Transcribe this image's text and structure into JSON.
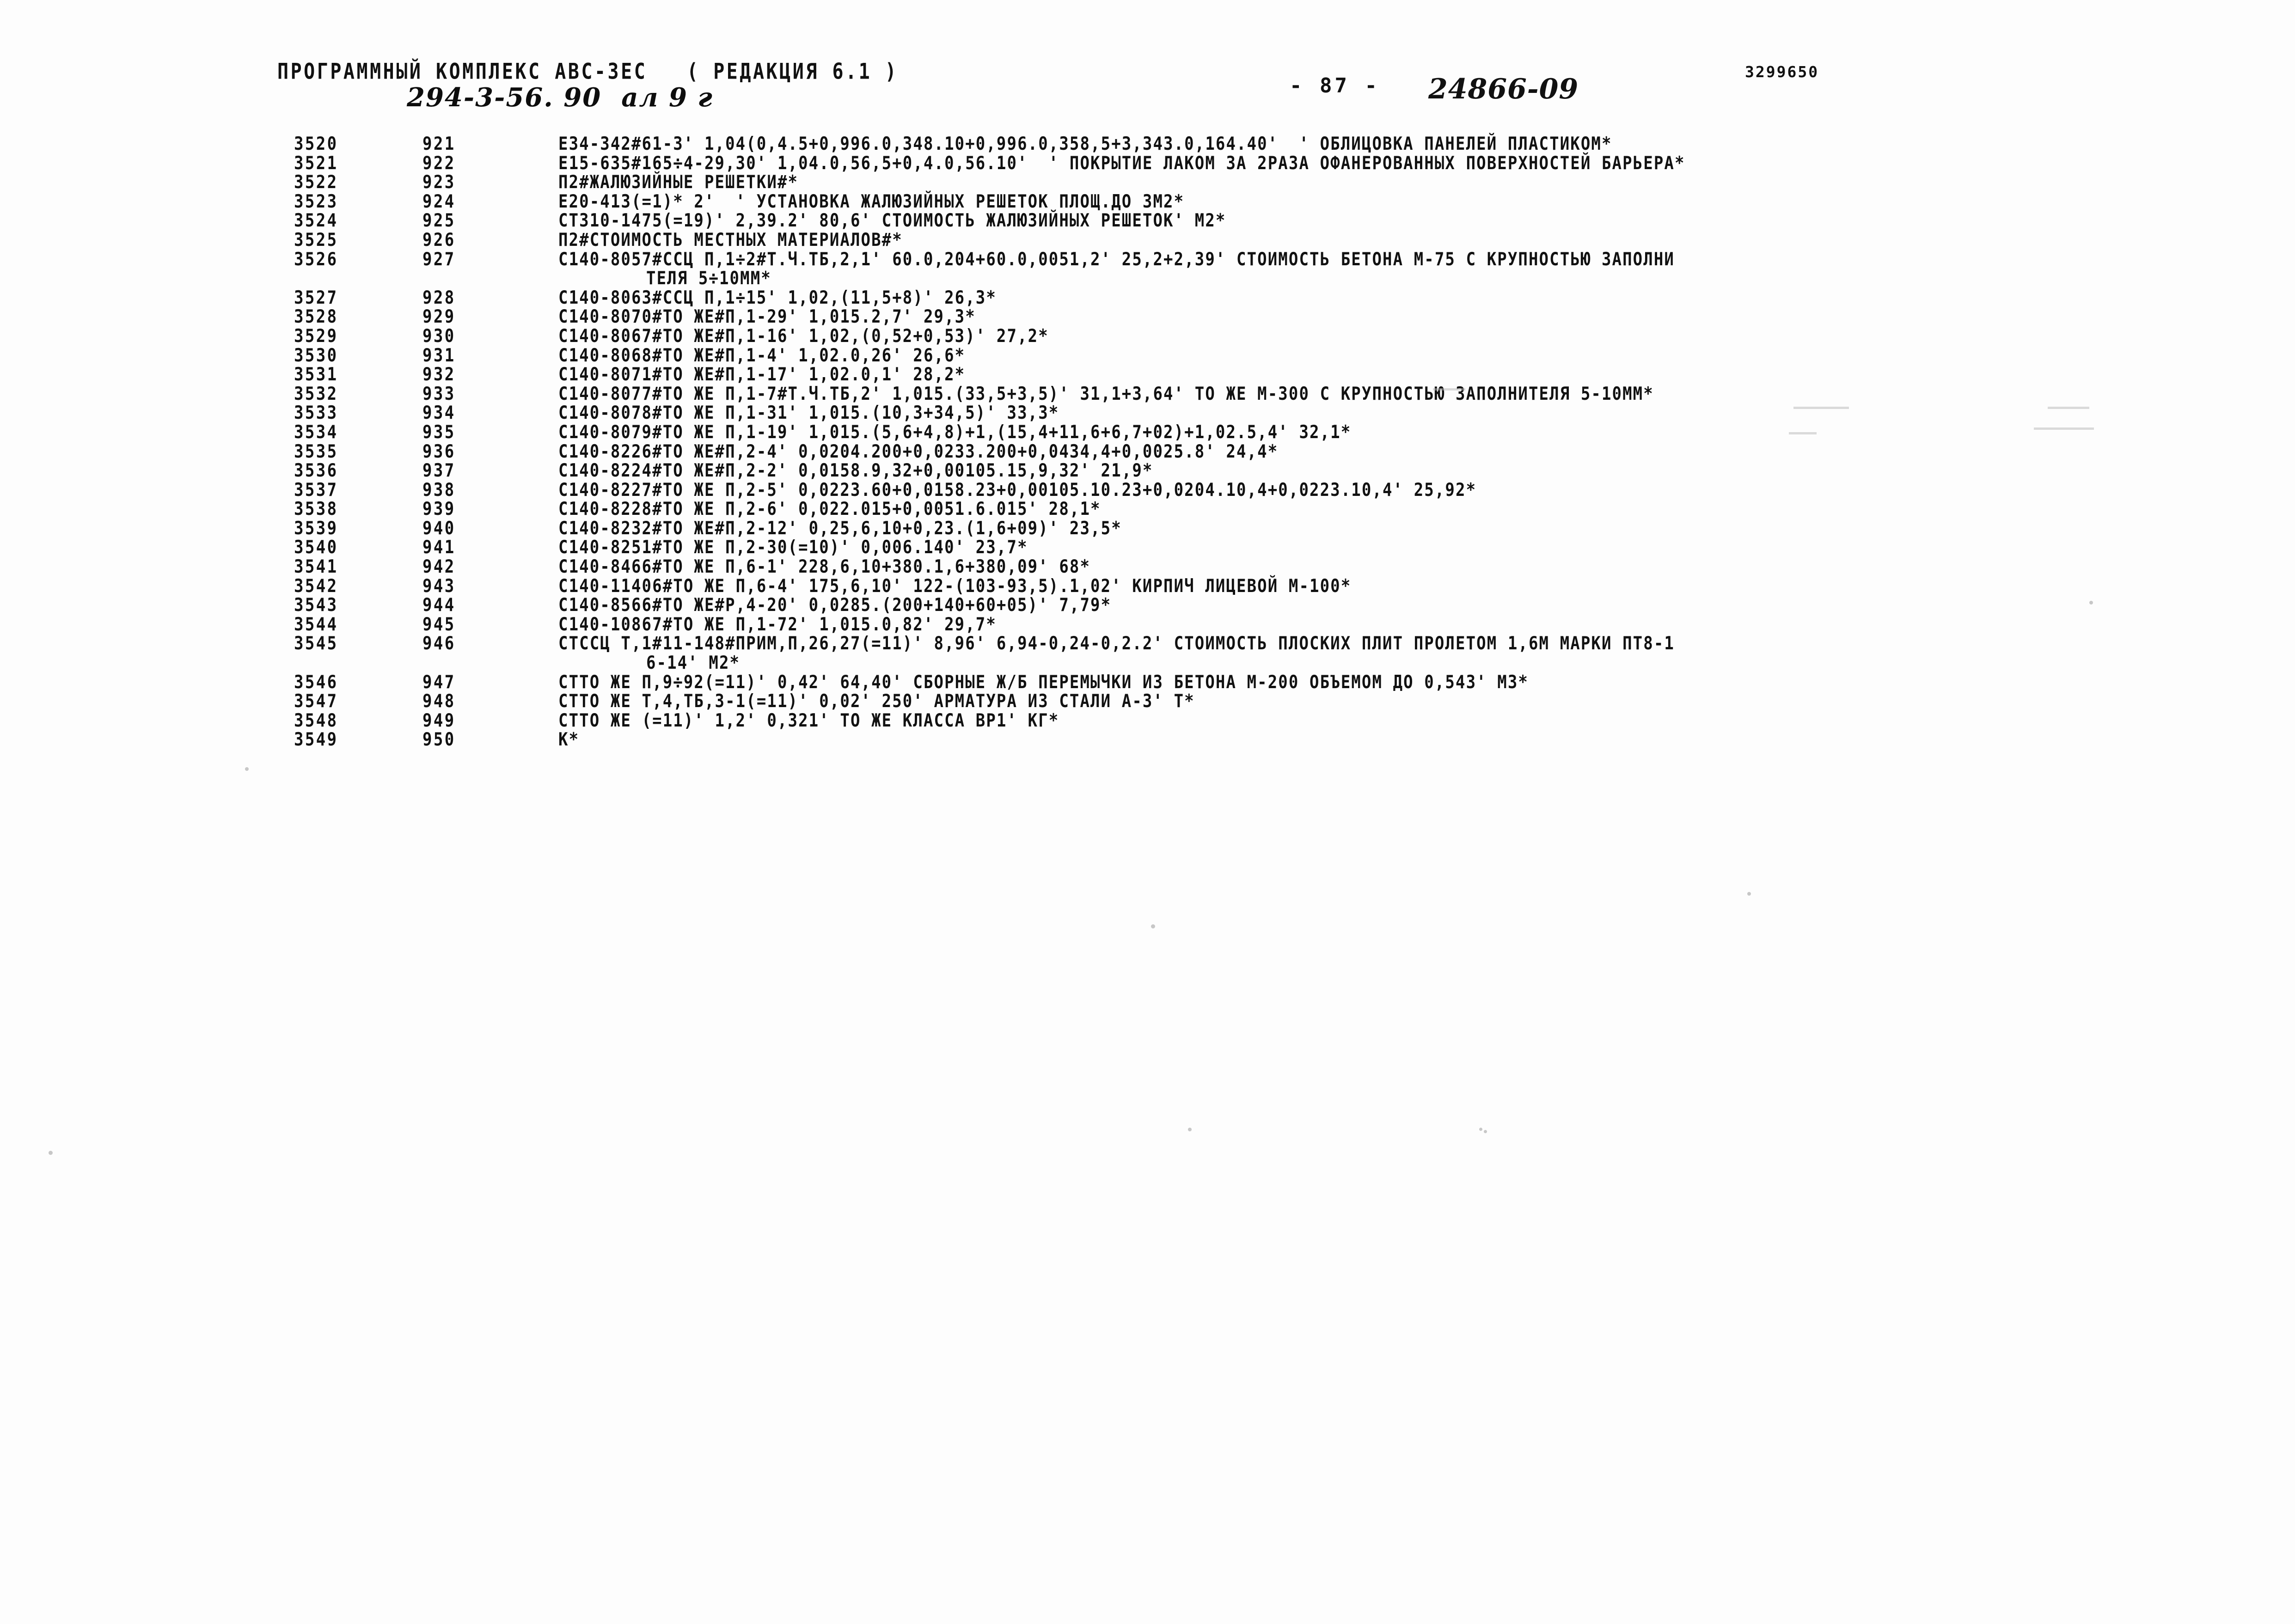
{
  "header": {
    "title": "ПРОГРАММНЫЙ КОМПЛЕКС АВС-3ЕС   ( РЕДАКЦИЯ 6.1 )",
    "handwritten_note": "294-3-56. 90  ал 9 г",
    "page_marker": "- 87 -",
    "handwritten_doc_number": "24866-09",
    "document_code": "3299650"
  },
  "listing": {
    "columns": [
      "seq",
      "num",
      "text"
    ],
    "rows": [
      {
        "seq": "3520",
        "num": "921",
        "text": "E34-342#61-3' 1,04(0,4.5+0,996.0,348.10+0,996.0,358,5+3,343.0,164.40'  ' ОБЛИЦОВКА ПАНЕЛЕЙ ПЛАСТИКОМ*",
        "continuation": false
      },
      {
        "seq": "3521",
        "num": "922",
        "text": "E15-635#165÷4-29,30' 1,04.0,56,5+0,4.0,56.10'  ' ПОКРЫТИЕ ЛАКОМ ЗА 2РАЗА ОФАНЕРОВАННЫХ ПОВЕРХНОСТЕЙ БАРЬЕРА*",
        "continuation": false
      },
      {
        "seq": "3522",
        "num": "923",
        "text": "П2#ЖАЛЮЗИЙНЫЕ РЕШЕТКИ#*",
        "continuation": false
      },
      {
        "seq": "3523",
        "num": "924",
        "text": "E20-413(=1)* 2'  ' УСТАНОВКА ЖАЛЮЗИЙНЫХ РЕШЕТОК ПЛОЩ.ДО 3М2*",
        "continuation": false
      },
      {
        "seq": "3524",
        "num": "925",
        "text": "СТ310-1475(=19)' 2,39.2' 80,6' СТОИМОСТЬ ЖАЛЮЗИЙНЫХ РЕШЕТОК' М2*",
        "continuation": false
      },
      {
        "seq": "3525",
        "num": "926",
        "text": "П2#СТОИМОСТЬ МЕСТНЫХ МАТЕРИАЛОВ#*",
        "continuation": false
      },
      {
        "seq": "3526",
        "num": "927",
        "text": "С140-8057#ССЦ П,1÷2#Т.Ч.ТБ,2,1' 60.0,204+60.0,0051,2' 25,2+2,39' СТОИМОСТЬ БЕТОНА М-75 С КРУПНОСТЬЮ ЗАПОЛНИ",
        "continuation": false
      },
      {
        "seq": "",
        "num": "",
        "text": "ТЕЛЯ 5÷10ММ*",
        "continuation": true
      },
      {
        "seq": "3527",
        "num": "928",
        "text": "С140-8063#ССЦ П,1÷15' 1,02,(11,5+8)' 26,3*",
        "continuation": false
      },
      {
        "seq": "3528",
        "num": "929",
        "text": "С140-8070#ТО ЖЕ#П,1-29' 1,015.2,7' 29,3*",
        "continuation": false
      },
      {
        "seq": "3529",
        "num": "930",
        "text": "С140-8067#ТО ЖЕ#П,1-16' 1,02,(0,52+0,53)' 27,2*",
        "continuation": false
      },
      {
        "seq": "3530",
        "num": "931",
        "text": "С140-8068#ТО ЖЕ#П,1-4' 1,02.0,26' 26,6*",
        "continuation": false
      },
      {
        "seq": "3531",
        "num": "932",
        "text": "С140-8071#ТО ЖЕ#П,1-17' 1,02.0,1' 28,2*",
        "continuation": false
      },
      {
        "seq": "3532",
        "num": "933",
        "text": "С140-8077#ТО ЖЕ П,1-7#Т.Ч.ТБ,2' 1,015.(33,5+3,5)' 31,1+3,64' ТО ЖЕ М-300 С КРУПНОСТЬЮ ЗАПОЛНИТЕЛЯ 5-10ММ*",
        "continuation": false
      },
      {
        "seq": "3533",
        "num": "934",
        "text": "С140-8078#ТО ЖЕ П,1-31' 1,015.(10,3+34,5)' 33,3*",
        "continuation": false
      },
      {
        "seq": "3534",
        "num": "935",
        "text": "С140-8079#ТО ЖЕ П,1-19' 1,015.(5,6+4,8)+1,(15,4+11,6+6,7+02)+1,02.5,4' 32,1*",
        "continuation": false
      },
      {
        "seq": "3535",
        "num": "936",
        "text": "С140-8226#ТО ЖЕ#П,2-4' 0,0204.200+0,0233.200+0,0434,4+0,0025.8' 24,4*",
        "continuation": false
      },
      {
        "seq": "3536",
        "num": "937",
        "text": "С140-8224#ТО ЖЕ#П,2-2' 0,0158.9,32+0,00105.15,9,32' 21,9*",
        "continuation": false
      },
      {
        "seq": "3537",
        "num": "938",
        "text": "С140-8227#ТО ЖЕ П,2-5' 0,0223.60+0,0158.23+0,00105.10.23+0,0204.10,4+0,0223.10,4' 25,92*",
        "continuation": false
      },
      {
        "seq": "3538",
        "num": "939",
        "text": "С140-8228#ТО ЖЕ П,2-6' 0,022.015+0,0051.6.015' 28,1*",
        "continuation": false
      },
      {
        "seq": "3539",
        "num": "940",
        "text": "С140-8232#ТО ЖЕ#П,2-12' 0,25,6,10+0,23.(1,6+09)' 23,5*",
        "continuation": false
      },
      {
        "seq": "3540",
        "num": "941",
        "text": "С140-8251#ТО ЖЕ П,2-30(=10)' 0,006.140' 23,7*",
        "continuation": false
      },
      {
        "seq": "3541",
        "num": "942",
        "text": "С140-8466#ТО ЖЕ П,6-1' 228,6,10+380.1,6+380,09' 68*",
        "continuation": false
      },
      {
        "seq": "3542",
        "num": "943",
        "text": "С140-11406#ТО ЖЕ П,6-4' 175,6,10' 122-(103-93,5).1,02' КИРПИЧ ЛИЦЕВОЙ М-100*",
        "continuation": false
      },
      {
        "seq": "3543",
        "num": "944",
        "text": "С140-8566#ТО ЖЕ#Р,4-20' 0,0285.(200+140+60+05)' 7,79*",
        "continuation": false
      },
      {
        "seq": "3544",
        "num": "945",
        "text": "С140-10867#ТО ЖЕ П,1-72' 1,015.0,82' 29,7*",
        "continuation": false
      },
      {
        "seq": "3545",
        "num": "946",
        "text": "СТССЦ Т,1#11-148#ПРИМ,П,26,27(=11)' 8,96' 6,94-0,24-0,2.2' СТОИМОСТЬ ПЛОСКИХ ПЛИТ ПРОЛЕТОМ 1,6М МАРКИ ПТ8-1",
        "continuation": false
      },
      {
        "seq": "",
        "num": "",
        "text": "6-14' М2*",
        "continuation": true
      },
      {
        "seq": "3546",
        "num": "947",
        "text": "СТТО ЖЕ П,9÷92(=11)' 0,42' 64,40' СБОРНЫЕ Ж/Б ПЕРЕМЫЧКИ ИЗ БЕТОНА М-200 ОБЪЕМОМ ДО 0,543' М3*",
        "continuation": false
      },
      {
        "seq": "3547",
        "num": "948",
        "text": "СТТО ЖЕ Т,4,ТБ,3-1(=11)' 0,02' 250' АРМАТУРА ИЗ СТАЛИ А-3' Т*",
        "continuation": false
      },
      {
        "seq": "3548",
        "num": "949",
        "text": "СТТО ЖЕ (=11)' 1,2' 0,321' ТО ЖЕ КЛАССА ВР1' КГ*",
        "continuation": false
      },
      {
        "seq": "3549",
        "num": "950",
        "text": "К*",
        "continuation": false
      }
    ]
  }
}
